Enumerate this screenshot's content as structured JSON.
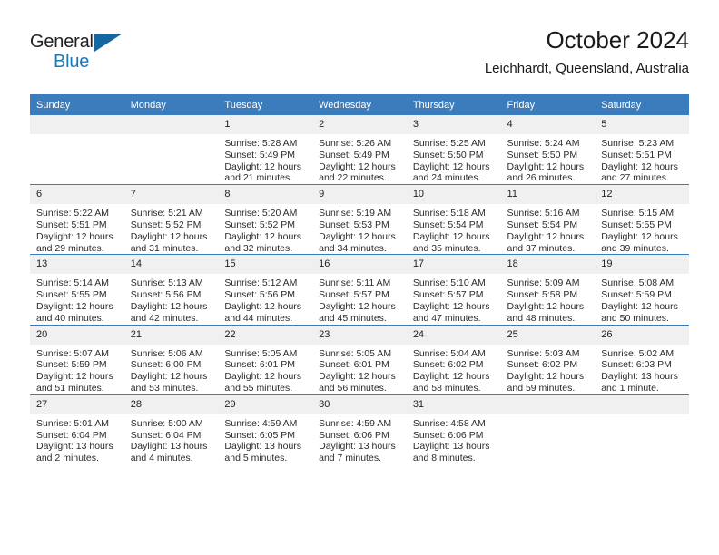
{
  "brand": {
    "word1": "General",
    "word2": "Blue",
    "triangle_color": "#15679f",
    "blue_color": "#1878be"
  },
  "header": {
    "title": "October 2024",
    "location": "Leichhardt, Queensland, Australia"
  },
  "theme": {
    "header_band": "#3b7cbd",
    "daynum_band": "#f0f0f0",
    "text": "#2b2b2b"
  },
  "weekdays": [
    "Sunday",
    "Monday",
    "Tuesday",
    "Wednesday",
    "Thursday",
    "Friday",
    "Saturday"
  ],
  "weeks": [
    [
      {
        "day": "",
        "lines": []
      },
      {
        "day": "",
        "lines": []
      },
      {
        "day": "1",
        "lines": [
          "Sunrise: 5:28 AM",
          "Sunset: 5:49 PM",
          "Daylight: 12 hours",
          "and 21 minutes."
        ]
      },
      {
        "day": "2",
        "lines": [
          "Sunrise: 5:26 AM",
          "Sunset: 5:49 PM",
          "Daylight: 12 hours",
          "and 22 minutes."
        ]
      },
      {
        "day": "3",
        "lines": [
          "Sunrise: 5:25 AM",
          "Sunset: 5:50 PM",
          "Daylight: 12 hours",
          "and 24 minutes."
        ]
      },
      {
        "day": "4",
        "lines": [
          "Sunrise: 5:24 AM",
          "Sunset: 5:50 PM",
          "Daylight: 12 hours",
          "and 26 minutes."
        ]
      },
      {
        "day": "5",
        "lines": [
          "Sunrise: 5:23 AM",
          "Sunset: 5:51 PM",
          "Daylight: 12 hours",
          "and 27 minutes."
        ]
      }
    ],
    [
      {
        "day": "6",
        "lines": [
          "Sunrise: 5:22 AM",
          "Sunset: 5:51 PM",
          "Daylight: 12 hours",
          "and 29 minutes."
        ]
      },
      {
        "day": "7",
        "lines": [
          "Sunrise: 5:21 AM",
          "Sunset: 5:52 PM",
          "Daylight: 12 hours",
          "and 31 minutes."
        ]
      },
      {
        "day": "8",
        "lines": [
          "Sunrise: 5:20 AM",
          "Sunset: 5:52 PM",
          "Daylight: 12 hours",
          "and 32 minutes."
        ]
      },
      {
        "day": "9",
        "lines": [
          "Sunrise: 5:19 AM",
          "Sunset: 5:53 PM",
          "Daylight: 12 hours",
          "and 34 minutes."
        ]
      },
      {
        "day": "10",
        "lines": [
          "Sunrise: 5:18 AM",
          "Sunset: 5:54 PM",
          "Daylight: 12 hours",
          "and 35 minutes."
        ]
      },
      {
        "day": "11",
        "lines": [
          "Sunrise: 5:16 AM",
          "Sunset: 5:54 PM",
          "Daylight: 12 hours",
          "and 37 minutes."
        ]
      },
      {
        "day": "12",
        "lines": [
          "Sunrise: 5:15 AM",
          "Sunset: 5:55 PM",
          "Daylight: 12 hours",
          "and 39 minutes."
        ]
      }
    ],
    [
      {
        "day": "13",
        "lines": [
          "Sunrise: 5:14 AM",
          "Sunset: 5:55 PM",
          "Daylight: 12 hours",
          "and 40 minutes."
        ]
      },
      {
        "day": "14",
        "lines": [
          "Sunrise: 5:13 AM",
          "Sunset: 5:56 PM",
          "Daylight: 12 hours",
          "and 42 minutes."
        ]
      },
      {
        "day": "15",
        "lines": [
          "Sunrise: 5:12 AM",
          "Sunset: 5:56 PM",
          "Daylight: 12 hours",
          "and 44 minutes."
        ]
      },
      {
        "day": "16",
        "lines": [
          "Sunrise: 5:11 AM",
          "Sunset: 5:57 PM",
          "Daylight: 12 hours",
          "and 45 minutes."
        ]
      },
      {
        "day": "17",
        "lines": [
          "Sunrise: 5:10 AM",
          "Sunset: 5:57 PM",
          "Daylight: 12 hours",
          "and 47 minutes."
        ]
      },
      {
        "day": "18",
        "lines": [
          "Sunrise: 5:09 AM",
          "Sunset: 5:58 PM",
          "Daylight: 12 hours",
          "and 48 minutes."
        ]
      },
      {
        "day": "19",
        "lines": [
          "Sunrise: 5:08 AM",
          "Sunset: 5:59 PM",
          "Daylight: 12 hours",
          "and 50 minutes."
        ]
      }
    ],
    [
      {
        "day": "20",
        "lines": [
          "Sunrise: 5:07 AM",
          "Sunset: 5:59 PM",
          "Daylight: 12 hours",
          "and 51 minutes."
        ]
      },
      {
        "day": "21",
        "lines": [
          "Sunrise: 5:06 AM",
          "Sunset: 6:00 PM",
          "Daylight: 12 hours",
          "and 53 minutes."
        ]
      },
      {
        "day": "22",
        "lines": [
          "Sunrise: 5:05 AM",
          "Sunset: 6:01 PM",
          "Daylight: 12 hours",
          "and 55 minutes."
        ]
      },
      {
        "day": "23",
        "lines": [
          "Sunrise: 5:05 AM",
          "Sunset: 6:01 PM",
          "Daylight: 12 hours",
          "and 56 minutes."
        ]
      },
      {
        "day": "24",
        "lines": [
          "Sunrise: 5:04 AM",
          "Sunset: 6:02 PM",
          "Daylight: 12 hours",
          "and 58 minutes."
        ]
      },
      {
        "day": "25",
        "lines": [
          "Sunrise: 5:03 AM",
          "Sunset: 6:02 PM",
          "Daylight: 12 hours",
          "and 59 minutes."
        ]
      },
      {
        "day": "26",
        "lines": [
          "Sunrise: 5:02 AM",
          "Sunset: 6:03 PM",
          "Daylight: 13 hours",
          "and 1 minute."
        ]
      }
    ],
    [
      {
        "day": "27",
        "lines": [
          "Sunrise: 5:01 AM",
          "Sunset: 6:04 PM",
          "Daylight: 13 hours",
          "and 2 minutes."
        ]
      },
      {
        "day": "28",
        "lines": [
          "Sunrise: 5:00 AM",
          "Sunset: 6:04 PM",
          "Daylight: 13 hours",
          "and 4 minutes."
        ]
      },
      {
        "day": "29",
        "lines": [
          "Sunrise: 4:59 AM",
          "Sunset: 6:05 PM",
          "Daylight: 13 hours",
          "and 5 minutes."
        ]
      },
      {
        "day": "30",
        "lines": [
          "Sunrise: 4:59 AM",
          "Sunset: 6:06 PM",
          "Daylight: 13 hours",
          "and 7 minutes."
        ]
      },
      {
        "day": "31",
        "lines": [
          "Sunrise: 4:58 AM",
          "Sunset: 6:06 PM",
          "Daylight: 13 hours",
          "and 8 minutes."
        ]
      },
      {
        "day": "",
        "lines": []
      },
      {
        "day": "",
        "lines": []
      }
    ]
  ]
}
